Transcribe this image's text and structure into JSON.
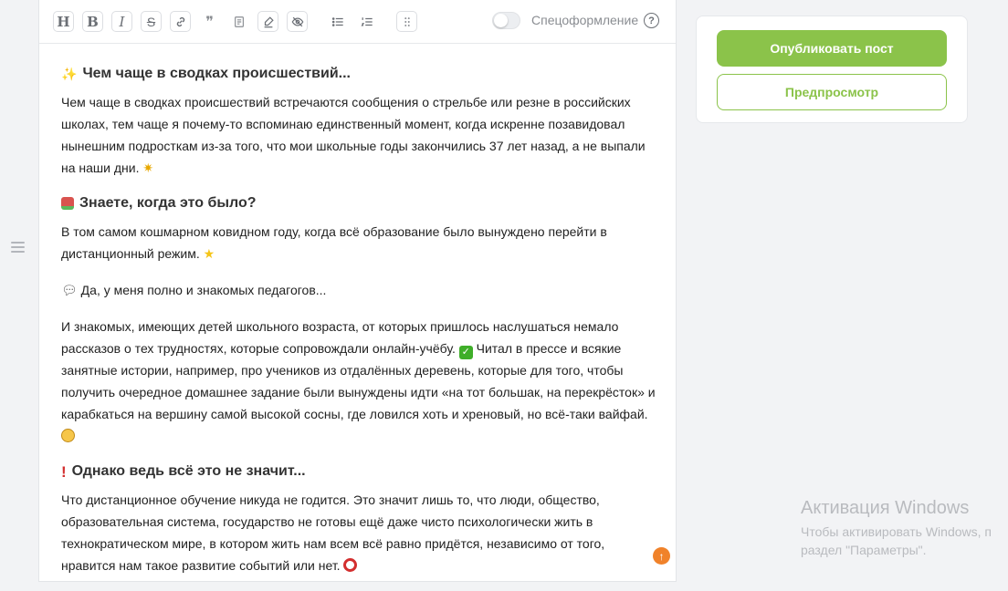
{
  "toolbar": {
    "buttons": [
      {
        "name": "heading-button",
        "icon": "heading-icon",
        "glyph": "H"
      },
      {
        "name": "bold-button",
        "icon": "bold-icon",
        "glyph": "B"
      },
      {
        "name": "italic-button",
        "icon": "italic-icon",
        "glyph": "I"
      },
      {
        "name": "strikethrough-button",
        "icon": "strikethrough-icon",
        "glyph": "S"
      },
      {
        "name": "link-button",
        "icon": "link-icon",
        "glyph": ""
      },
      {
        "name": "quote-button",
        "icon": "quote-icon",
        "glyph": "❞"
      },
      {
        "name": "embed-button",
        "icon": "document-icon",
        "glyph": ""
      },
      {
        "name": "marker-button",
        "icon": "marker-icon",
        "glyph": ""
      },
      {
        "name": "spoiler-button",
        "icon": "eye-off-icon",
        "glyph": ""
      },
      {
        "name": "bullet-list-button",
        "icon": "bullet-list-icon",
        "glyph": ""
      },
      {
        "name": "numbered-list-button",
        "icon": "numbered-list-icon",
        "glyph": ""
      },
      {
        "name": "more-button",
        "icon": "dots-grid-icon",
        "glyph": ""
      }
    ],
    "special_formatting_label": "Спецоформление",
    "special_formatting_enabled": false,
    "help_glyph": "?"
  },
  "article": {
    "section1": {
      "heading": "Чем чаще в сводках происшествий...",
      "heading_icon": "sparkles-icon",
      "paragraph": "Чем чаще в сводках происшествий встречаются сообщения о стрельбе или резне в российских школах, тем чаще я почему-то вспоминаю единственный момент, когда искренне позавидовал нынешним подросткам из-за того, что мои школьные годы закончились 37 лет назад, а не выпали на наши дни.",
      "paragraph_icon": "collision-icon"
    },
    "section2": {
      "heading": "Знаете, когда это было?",
      "heading_icon": "books-icon",
      "paragraph": "В том самом кошмарном ковидном году, когда всё образование было вынуждено перейти в дистанционный режим.",
      "paragraph_icon": "star-icon",
      "speech_line": "Да, у меня полно и знакомых педагогов...",
      "speech_icon": "speech-bubble-icon",
      "long_paragraph_a": "И знакомых, имеющих детей школьного возраста, от которых пришлось наслушаться немало рассказов о тех трудностях, которые сопровождали онлайн-учёбу.",
      "check_icon": "check-mark-icon",
      "long_paragraph_b": "Читал в прессе и всякие занятные истории, например, про учеников из отдалённых деревень, которые для того, чтобы получить очередное домашнее задание были вынуждены идти «на тот большак, на перекрёсток» и карабкаться на вершину самой высокой сосны, где ловился хоть и хреновый, но всё-таки вайфай.",
      "scream_icon": "screaming-face-icon"
    },
    "section3": {
      "heading": "Однако ведь всё это не значит...",
      "heading_icon": "exclamation-icon",
      "paragraph": "Что дистанционное обучение никуда не годится. Это значит лишь то, что люди, общество, образовательная система, государство не готовы ещё даже чисто психологически жить в технократическом мире, в котором жить нам всем всё равно придётся, независимо от того, нравится нам такое развитие событий или нет.",
      "paragraph_icon": "target-icon"
    }
  },
  "sidebar": {
    "publish_label": "Опубликовать пост",
    "preview_label": "Предпросмотр"
  },
  "windows_watermark": {
    "title": "Активация Windows",
    "line1": "Чтобы активировать Windows, п",
    "line2": "раздел \"Параметры\"."
  },
  "colors": {
    "accent_green": "#8bc34a",
    "scroll_button": "#f0822a"
  }
}
